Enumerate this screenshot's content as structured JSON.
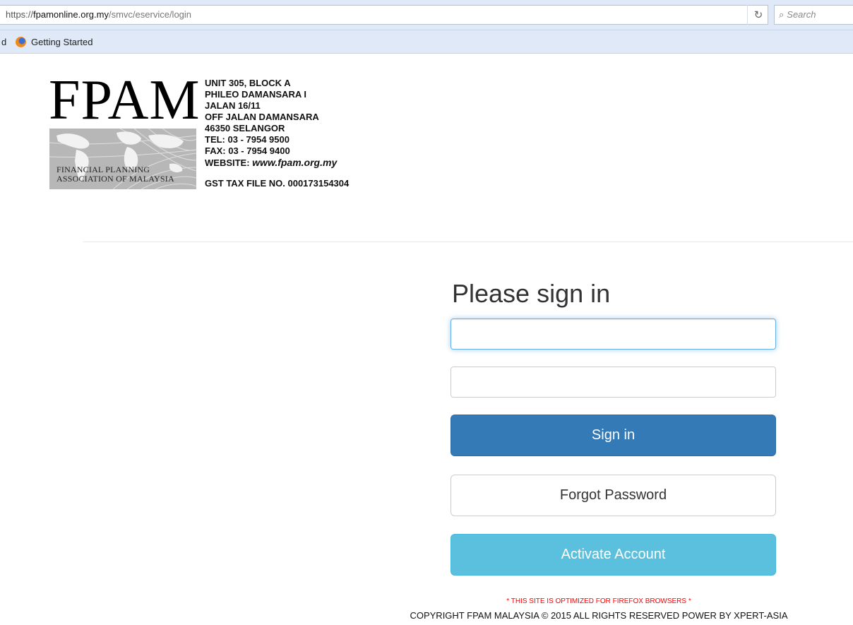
{
  "browser": {
    "url_scheme": "https://",
    "url_host": "fpamonline.org.my",
    "url_path": "/smvc/eservice/login",
    "reload_icon": "reload-icon",
    "search_placeholder": "Search",
    "bookmarks": {
      "partial_label": "d",
      "items": [
        {
          "label": "Getting Started",
          "icon": "firefox-icon"
        }
      ]
    }
  },
  "letterhead": {
    "logo_word": "FPAM",
    "logo_line1": "FINANCIAL PLANNING",
    "logo_line2": "ASSOCIATION OF MALAYSIA",
    "address_lines": [
      "UNIT 305, BLOCK A",
      "PHILEO DAMANSARA I",
      "JALAN 16/11",
      "OFF JALAN DAMANSARA",
      "46350 SELANGOR",
      "TEL:  03 - 7954 9500",
      "FAX:  03 - 7954 9400"
    ],
    "website_label": "WEBSITE: ",
    "website_url": "www.fpam.org.my",
    "gst": "GST TAX FILE NO. 000173154304"
  },
  "login": {
    "heading": "Please sign in",
    "username_value": "",
    "password_value": "",
    "signin_label": "Sign in",
    "forgot_label": "Forgot Password",
    "activate_label": "Activate Account"
  },
  "footer": {
    "notice": "* THIS SITE IS OPTIMIZED FOR FIREFOX BROWSERS *",
    "copyright": "COPYRIGHT FPAM MALAYSIA © 2015 ALL RIGHTS RESERVED POWER BY XPERT-ASIA"
  },
  "colors": {
    "primary": "#337ab7",
    "info": "#5bc0de",
    "notice": "#ff0000",
    "chrome": "#dfe9f7"
  }
}
